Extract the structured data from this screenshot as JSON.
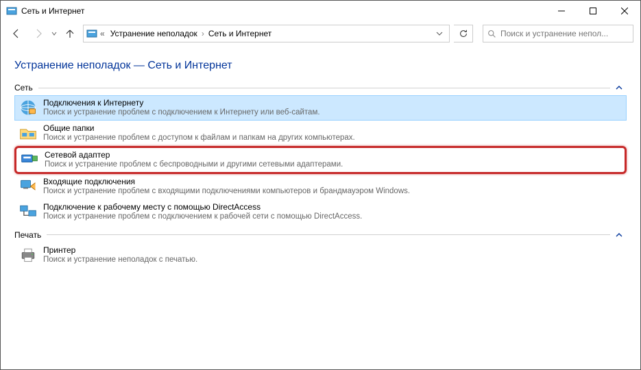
{
  "window": {
    "title": "Сеть и Интернет"
  },
  "breadcrumbs": {
    "prefix": "«",
    "items": [
      "Устранение неполадок",
      "Сеть и Интернет"
    ]
  },
  "search": {
    "placeholder": "Поиск и устранение непол..."
  },
  "heading": "Устранение неполадок — Сеть и Интернет",
  "categories": {
    "network": {
      "label": "Сеть",
      "items": [
        {
          "title": "Подключения к Интернету",
          "desc": "Поиск и устранение проблем с подключением к Интернету или веб-сайтам."
        },
        {
          "title": "Общие папки",
          "desc": "Поиск и устранение проблем с доступом к файлам и папкам на других компьютерах."
        },
        {
          "title": "Сетевой адаптер",
          "desc": "Поиск и устранение проблем с беспроводными и другими сетевыми адаптерами."
        },
        {
          "title": "Входящие подключения",
          "desc": "Поиск и устранение проблем с входящими подключениями компьютеров и брандмауэром Windows."
        },
        {
          "title": "Подключение к рабочему месту с помощью DirectAccess",
          "desc": "Поиск и устранение проблем с подключением к рабочей сети с помощью DirectAccess."
        }
      ]
    },
    "print": {
      "label": "Печать",
      "items": [
        {
          "title": "Принтер",
          "desc": "Поиск и устранение неполадок с печатью."
        }
      ]
    }
  }
}
